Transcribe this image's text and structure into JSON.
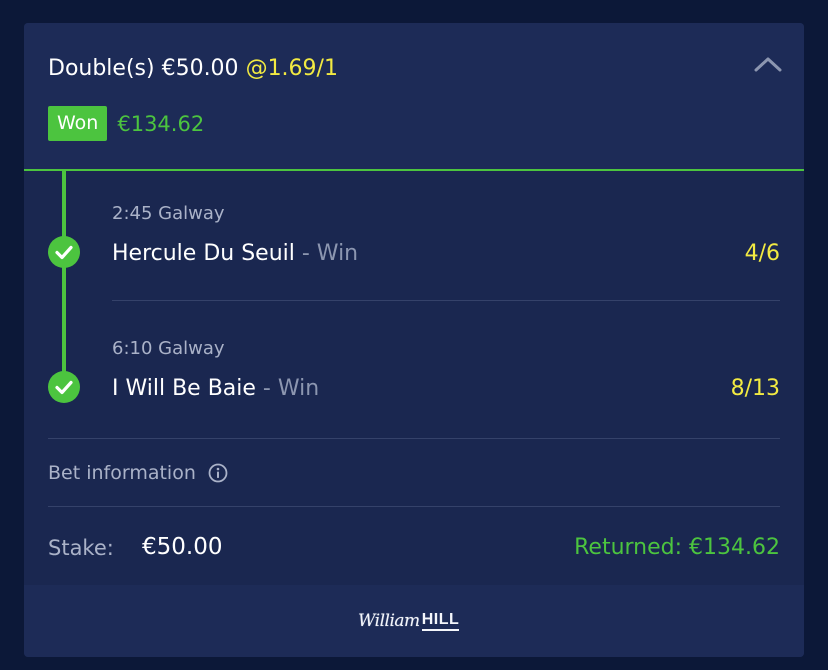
{
  "bet": {
    "type_stake": "Double(s) €50.00",
    "odds": "@1.69/1",
    "status_badge": "Won",
    "won_amount": "€134.62"
  },
  "legs": [
    {
      "race": "2:45 Galway",
      "selection": "Hercule Du Seuil",
      "market": " - Win",
      "odds": "4/6"
    },
    {
      "race": "6:10 Galway",
      "selection": "I Will Be Baie",
      "market": " - Win",
      "odds": "8/13"
    }
  ],
  "bet_info": {
    "label": "Bet information"
  },
  "summary": {
    "stake_label": "Stake:",
    "stake_value": "€50.00",
    "returned": "Returned: €134.62"
  },
  "footer": {
    "logo_script": "William",
    "logo_bold": "HILL"
  },
  "colors": {
    "accent_green": "#4cc43f",
    "odds_yellow": "#f2ea42",
    "card_bg": "#1a2750",
    "page_bg": "#0c1838"
  },
  "icons": {
    "collapse": "chevron-up-icon",
    "leg_status": "check-circle-icon",
    "info": "info-circle-icon"
  }
}
